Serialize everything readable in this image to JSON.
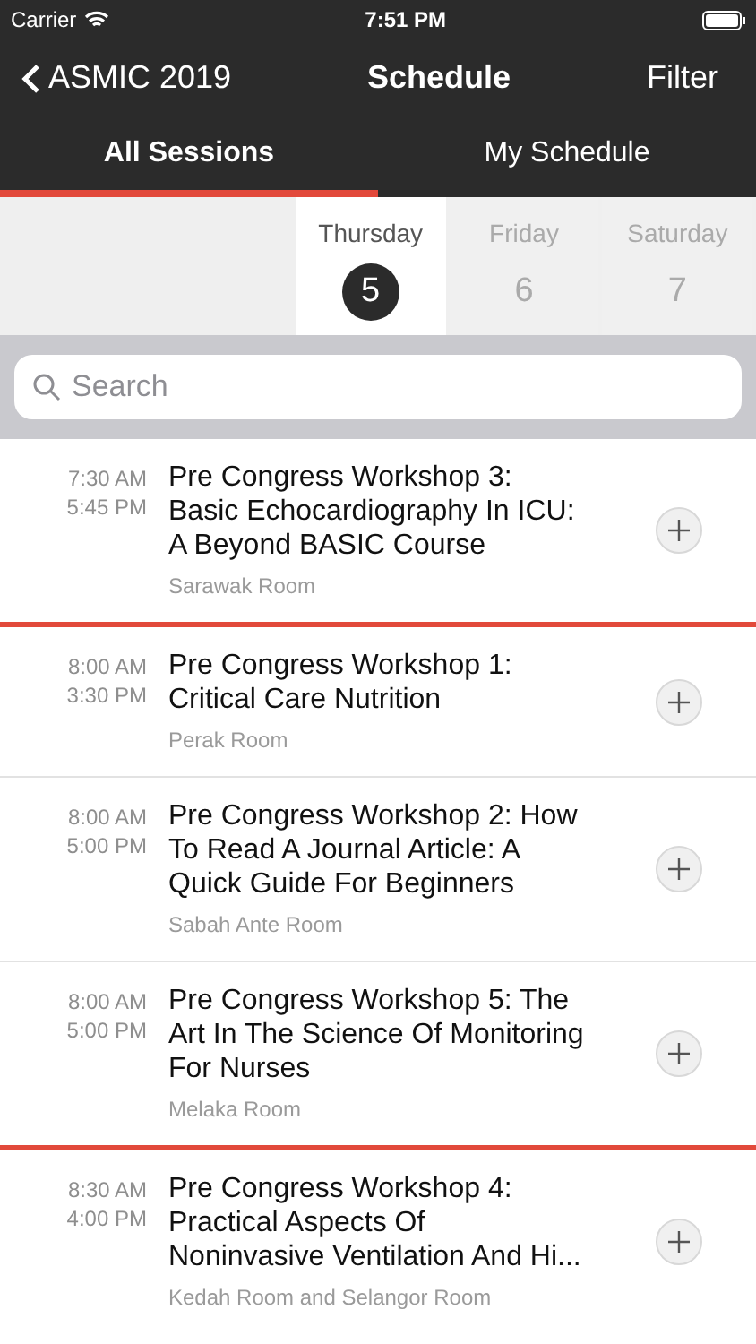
{
  "status_bar": {
    "carrier": "Carrier",
    "time": "7:51 PM"
  },
  "nav": {
    "back": "ASMIC 2019",
    "title": "Schedule",
    "action": "Filter"
  },
  "tabs": [
    {
      "label": "All Sessions",
      "selected": true
    },
    {
      "label": "My Schedule",
      "selected": false
    }
  ],
  "days": [
    {
      "weekday": "Thursday",
      "date": "5",
      "selected": true
    },
    {
      "weekday": "Friday",
      "date": "6",
      "selected": false
    },
    {
      "weekday": "Saturday",
      "date": "7",
      "selected": false
    }
  ],
  "search": {
    "placeholder": "Search"
  },
  "groups": [
    {
      "sessions": [
        {
          "start": "7:30 AM",
          "end": "5:45 PM",
          "title": "Pre Congress Workshop 3: Basic Echocardiography In ICU: A Beyond BASIC Course",
          "room": "Sarawak Room"
        }
      ]
    },
    {
      "sessions": [
        {
          "start": "8:00 AM",
          "end": "3:30 PM",
          "title": "Pre Congress Workshop 1: Critical Care Nutrition",
          "room": "Perak Room"
        },
        {
          "start": "8:00 AM",
          "end": "5:00 PM",
          "title": "Pre Congress Workshop 2: How To Read A Journal Article: A Quick Guide For Beginners",
          "room": "Sabah Ante Room"
        },
        {
          "start": "8:00 AM",
          "end": "5:00 PM",
          "title": "Pre Congress Workshop 5: The Art In The Science Of Monitoring For Nurses",
          "room": "Melaka Room"
        }
      ]
    },
    {
      "sessions": [
        {
          "start": "8:30 AM",
          "end": "4:00 PM",
          "title": "Pre Congress Workshop 4: Practical Aspects Of Noninvasive Ventilation And Hi...",
          "room": "Kedah Room and Selangor Room"
        }
      ]
    }
  ]
}
